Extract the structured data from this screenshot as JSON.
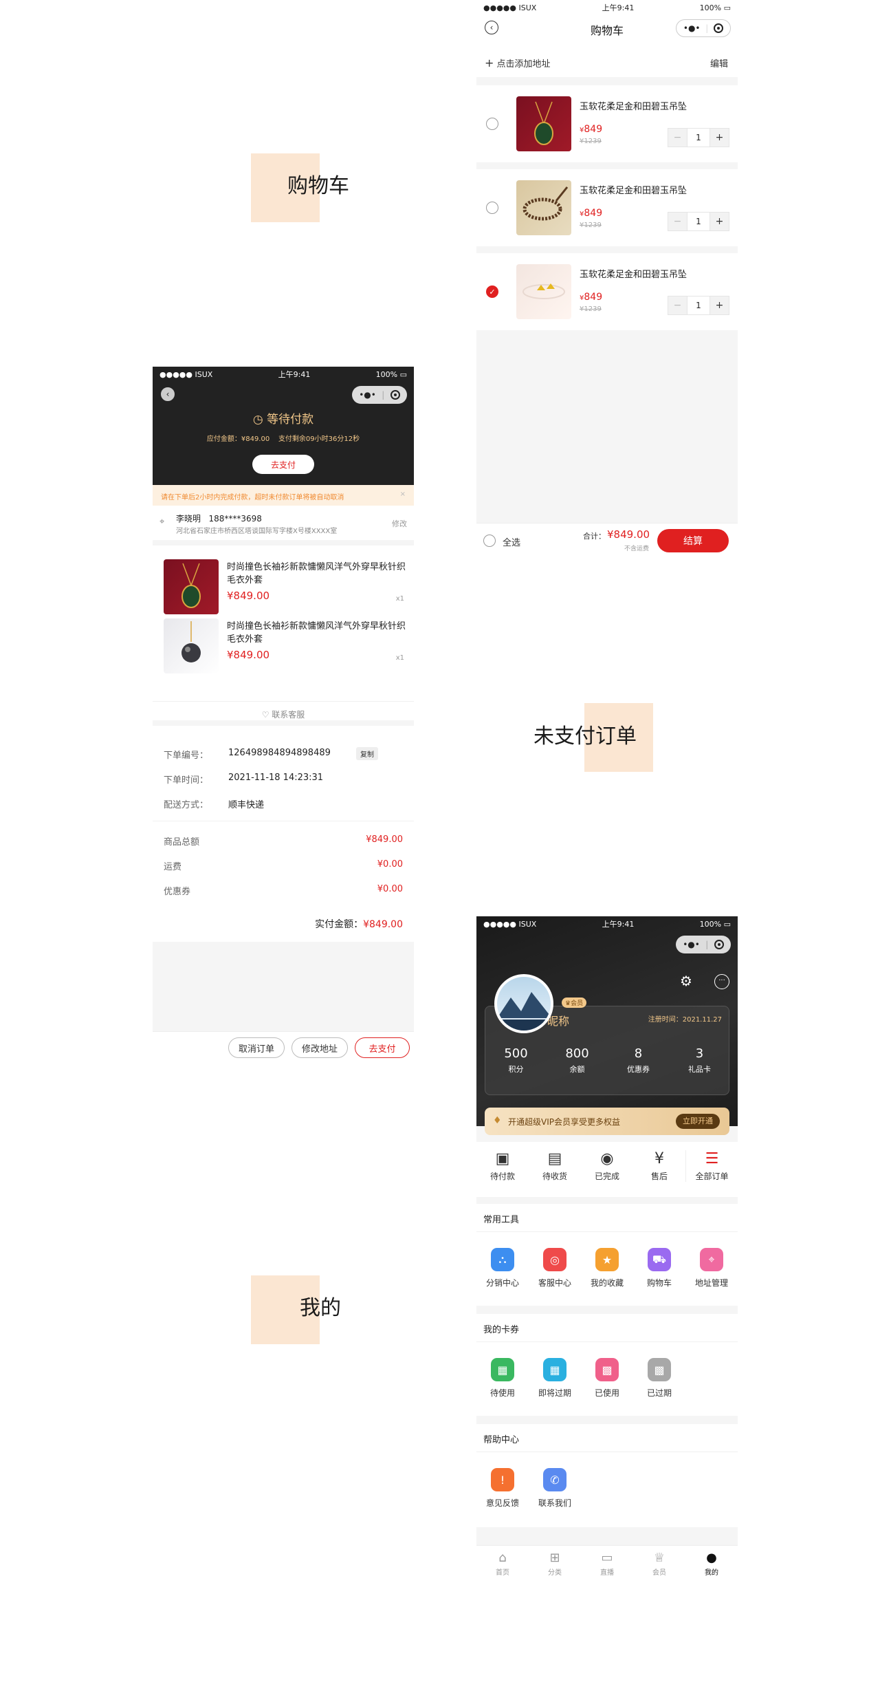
{
  "labels": {
    "cart": "购物车",
    "unpaid": "未支付订单",
    "mine": "我的"
  },
  "status": {
    "carrier": "ISUX",
    "time": "上午9:41",
    "battery": "100%"
  },
  "cart": {
    "title": "购物车",
    "add_address": "点击添加地址",
    "edit": "编辑",
    "items": [
      {
        "name": "玉软花柔足金和田碧玉吊坠",
        "price": "849",
        "old_price": "1239",
        "qty": "1",
        "checked": false
      },
      {
        "name": "玉软花柔足金和田碧玉吊坠",
        "price": "849",
        "old_price": "1239",
        "qty": "1",
        "checked": false
      },
      {
        "name": "玉软花柔足金和田碧玉吊坠",
        "price": "849",
        "old_price": "1239",
        "qty": "1",
        "checked": true
      }
    ],
    "currency": "¥",
    "select_all": "全选",
    "total_label": "合计：",
    "total": "¥849.00",
    "shipping_note": "不含运费",
    "checkout": "结算"
  },
  "order": {
    "status_title": "等待付款",
    "due_label": "应付金额：",
    "due_value": "¥849.00",
    "remain_label": "支付剩余09小时36分12秒",
    "pay_button": "去支付",
    "notice": "请在下单后2小时内完成付款，超时未付款订单将被自动取消",
    "notice_close": "×",
    "recipient": "李晓明",
    "phone": "188****3698",
    "address": "河北省石家庄市桥西区塔谈国际写字楼X号楼XXXX室",
    "modify": "修改",
    "items": [
      {
        "name": "时尚撞色长袖衫新款慵懒风洋气外穿早秋针织毛衣外套",
        "price": "¥849.00",
        "qty": "x1"
      },
      {
        "name": "时尚撞色长袖衫新款慵懒风洋气外穿早秋针织毛衣外套",
        "price": "¥849.00",
        "qty": "x1"
      }
    ],
    "contact_service": "联系客服",
    "order_no_label": "下单编号：",
    "order_no": "126498984894898489",
    "copy": "复制",
    "order_time_label": "下单时间：",
    "order_time": "2021-11-18  14:23:31",
    "delivery_label": "配送方式：",
    "delivery": "顺丰快递",
    "goods_total_label": "商品总额",
    "goods_total": "¥849.00",
    "freight_label": "运费",
    "freight": "¥0.00",
    "coupon_label": "优惠券",
    "coupon": "¥0.00",
    "paid_label": "实付金额：",
    "paid": "¥849.00",
    "cancel": "取消订单",
    "change_address": "修改地址",
    "go_pay": "去支付"
  },
  "mine": {
    "nickname": "昵称",
    "badge": "会员",
    "reg_label": "注册时间：",
    "reg_date": "2021.11.27",
    "stats": [
      {
        "value": "500",
        "label": "积分"
      },
      {
        "value": "800",
        "label": "余额"
      },
      {
        "value": "8",
        "label": "优惠券"
      },
      {
        "value": "3",
        "label": "礼品卡"
      }
    ],
    "vip_text": "开通超级VIP会员享受更多权益",
    "vip_button": "立即开通",
    "orders": [
      "待付款",
      "待收货",
      "已完成",
      "售后",
      "全部订单"
    ],
    "tools_title": "常用工具",
    "tools": [
      "分销中心",
      "客服中心",
      "我的收藏",
      "购物车",
      "地址管理"
    ],
    "cards_title": "我的卡券",
    "cards": [
      "待使用",
      "即将过期",
      "已使用",
      "已过期"
    ],
    "help_title": "帮助中心",
    "help": [
      "意见反馈",
      "联系我们"
    ],
    "tabs": [
      "首页",
      "分类",
      "直播",
      "会员",
      "我的"
    ],
    "colors": {
      "accent": "#e02020",
      "gold": "#c9a063",
      "dark": "#222222"
    }
  }
}
